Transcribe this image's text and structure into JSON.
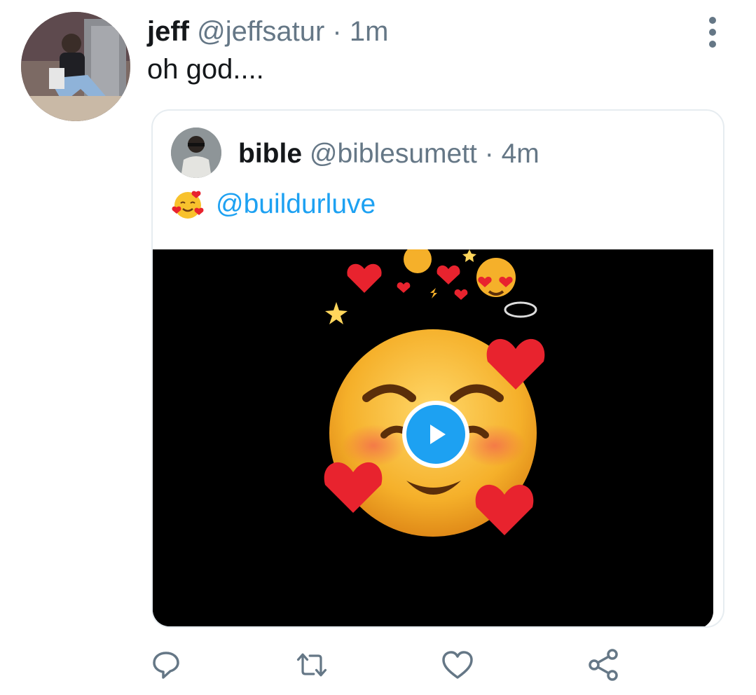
{
  "tweet": {
    "author_name": "jeff",
    "author_handle": "@jeffsatur",
    "separator": "·",
    "time": "1m",
    "text": "oh god...."
  },
  "quoted_tweet": {
    "author_name": "bible",
    "author_handle": "@biblesumett",
    "separator": "·",
    "time": "4m",
    "emoji": "smiling-face-with-hearts",
    "mention": "@buildurluve",
    "media_type": "video"
  },
  "actions": {
    "reply_icon": "reply-icon",
    "retweet_icon": "retweet-icon",
    "like_icon": "heart-icon",
    "share_icon": "share-icon"
  },
  "colors": {
    "accent": "#1da1f2",
    "secondary_text": "#657786",
    "border": "#e6ecf0",
    "primary_text": "#14171a"
  }
}
